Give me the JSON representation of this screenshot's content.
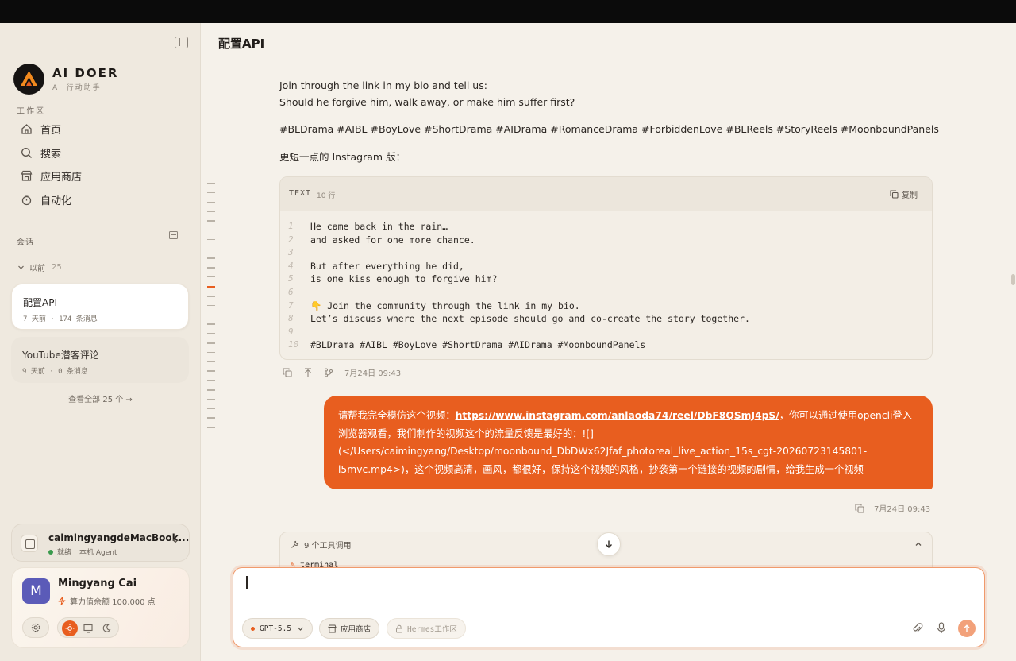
{
  "sidebar": {
    "brand_name": "AI DOER",
    "brand_sub": "AI 行动助手",
    "workspace_label": "工作区",
    "nav": [
      {
        "label": "首页",
        "icon": "home-icon"
      },
      {
        "label": "搜索",
        "icon": "search-icon"
      },
      {
        "label": "应用商店",
        "icon": "store-icon"
      },
      {
        "label": "自动化",
        "icon": "timer-icon"
      }
    ],
    "sessions_label": "会话",
    "earlier_label": "以前",
    "earlier_count": "25",
    "conversations": [
      {
        "title": "配置API",
        "meta": "7 天前 · 174 条消息",
        "active": true
      },
      {
        "title": "YouTube潜客评论",
        "meta": "9 天前 · 0 条消息",
        "active": false
      }
    ],
    "view_all": "查看全部 25 个 →",
    "device": {
      "name": "caimingyangdeMacBook...",
      "status": "就绪",
      "agent": "本机 Agent"
    },
    "user": {
      "initial": "M",
      "name": "Mingyang Cai",
      "credits": "算力值余额 100,000 点"
    }
  },
  "header": {
    "title": "配置API"
  },
  "messages": {
    "para1": [
      "Join through the link in my bio and tell us:",
      "Should he forgive him, walk away, or make him suffer first?"
    ],
    "hashtags": "#BLDrama #AIBL #BoyLove #ShortDrama #AIDrama #RomanceDrama #ForbiddenLove #BLReels #StoryReels #MoonboundPanels",
    "short_intro": "更短一点的 Instagram 版：",
    "code": {
      "lang": "TEXT",
      "lines_label": "10 行",
      "copy_label": "复制",
      "lines": [
        {
          "n": "1",
          "t": "He came back in the rain…"
        },
        {
          "n": "2",
          "t": "and asked for one more chance."
        },
        {
          "n": "3",
          "t": ""
        },
        {
          "n": "4",
          "t": "But after everything he did,"
        },
        {
          "n": "5",
          "t": "is one kiss enough to forgive him?"
        },
        {
          "n": "6",
          "t": ""
        },
        {
          "n": "7",
          "t": "👇 Join the community through the link in my bio."
        },
        {
          "n": "8",
          "t": "Let’s discuss where the next episode should go and co-create the story together."
        },
        {
          "n": "9",
          "t": ""
        },
        {
          "n": "10",
          "t": "#BLDrama #AIBL #BoyLove #ShortDrama #AIDrama #MoonboundPanels"
        }
      ]
    },
    "assistant_time": "7月24日 09:43",
    "user_msg": {
      "prefix": "请帮我完全模仿这个视频：",
      "link": "https://www.instagram.com/anlaoda74/reel/DbF8QSmJ4pS/",
      "suffix": "，你可以通过使用opencli登入浏览器观看，我们制作的视频这个的流量反馈是最好的：![](</Users/caimingyang/Desktop/moonbound_DbDWx62Jfaf_photoreal_live_action_15s_cgt-20260723145801-l5mvc.mp4>)，这个视频高清，画风，都很好，保持这个视频的风格，抄袭第一个链接的视频的剧情，给我生成一个视频",
      "time": "7月24日 09:43"
    },
    "tools": {
      "label": "9 个工具调用",
      "item": "terminal"
    }
  },
  "composer": {
    "placeholder": "",
    "model": "GPT-5.5",
    "store": "应用商店",
    "hermes": "Hermes工作区"
  },
  "colors": {
    "accent": "#e85e1f",
    "background": "#f5f1ea",
    "sidebar": "#efe9df"
  }
}
